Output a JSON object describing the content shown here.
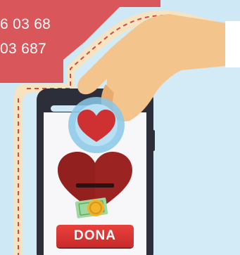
{
  "banner": {
    "phone_line_1": "6 03 68",
    "phone_line_2": "03 687",
    "color": "#d9575a"
  },
  "phone": {
    "button_label": "DONA",
    "button_color": "#e23a36",
    "screen_color": "#f7f7f9",
    "frame_color": "#2c2f3a"
  },
  "icons": {
    "hand": "hand-icon",
    "heart_bubble": "heart-bubble-icon",
    "donation_slot_heart": "heart-slot-icon",
    "coin": "coin-icon",
    "banknote": "banknote-icon"
  },
  "colors": {
    "background": "#cfe8f5",
    "sticker_border": "#f3ddb7",
    "dashed_line": "#d24a4a",
    "heart_dark": "#9b2423",
    "skin": "#f4c48d"
  }
}
